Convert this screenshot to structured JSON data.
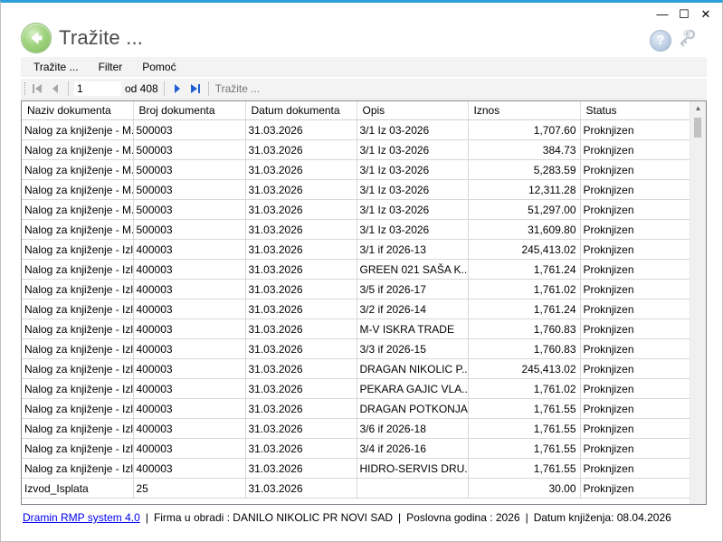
{
  "window": {
    "title": "Tražite ...",
    "controls": {
      "minimize": "—",
      "maximize": "☐",
      "close": "✕"
    }
  },
  "menu": [
    {
      "label": "Tražite ..."
    },
    {
      "label": "Filter"
    },
    {
      "label": "Pomoć"
    }
  ],
  "toolbar": {
    "page_value": "1",
    "of_label": "od 408",
    "search_placeholder": "Tražite ..."
  },
  "table": {
    "columns": [
      "Naziv dokumenta",
      "Broj dokumenta",
      "Datum dokumenta",
      "Opis",
      "Iznos",
      "Status"
    ],
    "rows": [
      [
        "Nalog za knjiženje - M...",
        "500003",
        "31.03.2026",
        "3/1 Iz 03-2026",
        "1,707.60",
        "Proknjizen"
      ],
      [
        "Nalog za knjiženje - M...",
        "500003",
        "31.03.2026",
        "3/1 Iz 03-2026",
        "384.73",
        "Proknjizen"
      ],
      [
        "Nalog za knjiženje - M...",
        "500003",
        "31.03.2026",
        "3/1 Iz 03-2026",
        "5,283.59",
        "Proknjizen"
      ],
      [
        "Nalog za knjiženje - M...",
        "500003",
        "31.03.2026",
        "3/1 Iz 03-2026",
        "12,311.28",
        "Proknjizen"
      ],
      [
        "Nalog za knjiženje - M...",
        "500003",
        "31.03.2026",
        "3/1 Iz 03-2026",
        "51,297.00",
        "Proknjizen"
      ],
      [
        "Nalog za knjiženje - M...",
        "500003",
        "31.03.2026",
        "3/1 Iz 03-2026",
        "31,609.80",
        "Proknjizen"
      ],
      [
        "Nalog za knjiženje - Izl...",
        "400003",
        "31.03.2026",
        "3/1 if 2026-13",
        "245,413.02",
        "Proknjizen"
      ],
      [
        "Nalog za knjiženje - Izl...",
        "400003",
        "31.03.2026",
        "GREEN 021 SAŠA K...",
        "1,761.24",
        "Proknjizen"
      ],
      [
        "Nalog za knjiženje - Izl...",
        "400003",
        "31.03.2026",
        "3/5 if 2026-17",
        "1,761.02",
        "Proknjizen"
      ],
      [
        "Nalog za knjiženje - Izl...",
        "400003",
        "31.03.2026",
        "3/2 if 2026-14",
        "1,761.24",
        "Proknjizen"
      ],
      [
        "Nalog za knjiženje - Izl...",
        "400003",
        "31.03.2026",
        "M-V ISKRA TRADE",
        "1,760.83",
        "Proknjizen"
      ],
      [
        "Nalog za knjiženje - Izl...",
        "400003",
        "31.03.2026",
        "3/3 if 2026-15",
        "1,760.83",
        "Proknjizen"
      ],
      [
        "Nalog za knjiženje - Izl...",
        "400003",
        "31.03.2026",
        "DRAGAN NIKOLIC P...",
        "245,413.02",
        "Proknjizen"
      ],
      [
        "Nalog za knjiženje - Izl...",
        "400003",
        "31.03.2026",
        "PEKARA GAJIC VLA...",
        "1,761.02",
        "Proknjizen"
      ],
      [
        "Nalog za knjiženje - Izl...",
        "400003",
        "31.03.2026",
        "DRAGAN POTKONJA...",
        "1,761.55",
        "Proknjizen"
      ],
      [
        "Nalog za knjiženje - Izl...",
        "400003",
        "31.03.2026",
        "3/6 if 2026-18",
        "1,761.55",
        "Proknjizen"
      ],
      [
        "Nalog za knjiženje - Izl...",
        "400003",
        "31.03.2026",
        "3/4 if 2026-16",
        "1,761.55",
        "Proknjizen"
      ],
      [
        "Nalog za knjiženje - Izl...",
        "400003",
        "31.03.2026",
        "HIDRO-SERVIS DRU...",
        "1,761.55",
        "Proknjizen"
      ],
      [
        "Izvod_Isplata",
        "25",
        "31.03.2026",
        "",
        "30.00",
        "Proknjizen"
      ]
    ]
  },
  "status": {
    "app_link": "Dramin RMP system 4.0",
    "firm": "Firma u obradi : DANILO NIKOLIC PR NOVI SAD",
    "year": "Poslovna godina : 2026",
    "date": "Datum knjiženja: 08.04.2026"
  },
  "colors": {
    "accent_top": "#2a9fd8",
    "back_button": "#7bbd5a",
    "link": "#0000ee"
  }
}
